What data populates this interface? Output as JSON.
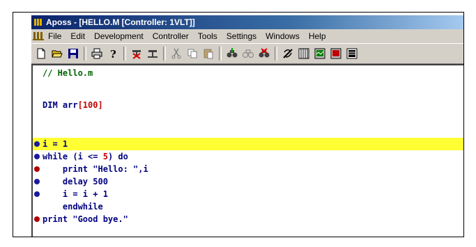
{
  "window": {
    "title": "Aposs - [HELLO.M [Controller: 1VLT]]"
  },
  "menu": {
    "items": [
      "File",
      "Edit",
      "Development",
      "Controller",
      "Tools",
      "Settings",
      "Windows",
      "Help"
    ]
  },
  "toolbar": {
    "buttons": [
      "new-icon",
      "open-icon",
      "save-icon",
      "print-icon",
      "help-icon",
      "disconnect-icon",
      "connect-icon",
      "cut-icon",
      "copy-icon",
      "paste-icon",
      "find-icon",
      "find-next-icon",
      "replace-icon",
      "link-icon",
      "grid-icon",
      "monitor-icon",
      "terminal-icon",
      "panel-icon"
    ]
  },
  "editor": {
    "lines": [
      {
        "text": "// Hello.m",
        "breakpoint": null,
        "highlight": false
      },
      {
        "text": "",
        "breakpoint": null,
        "highlight": false
      },
      {
        "text": "DIM arr[100]",
        "breakpoint": null,
        "highlight": false
      },
      {
        "text": "",
        "breakpoint": null,
        "highlight": false
      },
      {
        "text": "i = 1",
        "breakpoint": "blue",
        "highlight": true
      },
      {
        "text": "while (i <= 5) do",
        "breakpoint": "blue",
        "highlight": false
      },
      {
        "text": "    print \"Hello: \",i",
        "breakpoint": "red",
        "highlight": false
      },
      {
        "text": "    delay 500",
        "breakpoint": "blue",
        "highlight": false
      },
      {
        "text": "    i = i + 1",
        "breakpoint": "blue",
        "highlight": false
      },
      {
        "text": "    endwhile",
        "breakpoint": null,
        "highlight": false
      },
      {
        "text": "print \"Good bye.\"",
        "breakpoint": "red",
        "highlight": false
      }
    ]
  },
  "colors": {
    "blue_breakpoint": "#1a1aa0",
    "red_breakpoint": "#b00000",
    "highlight": "#ffff33"
  }
}
